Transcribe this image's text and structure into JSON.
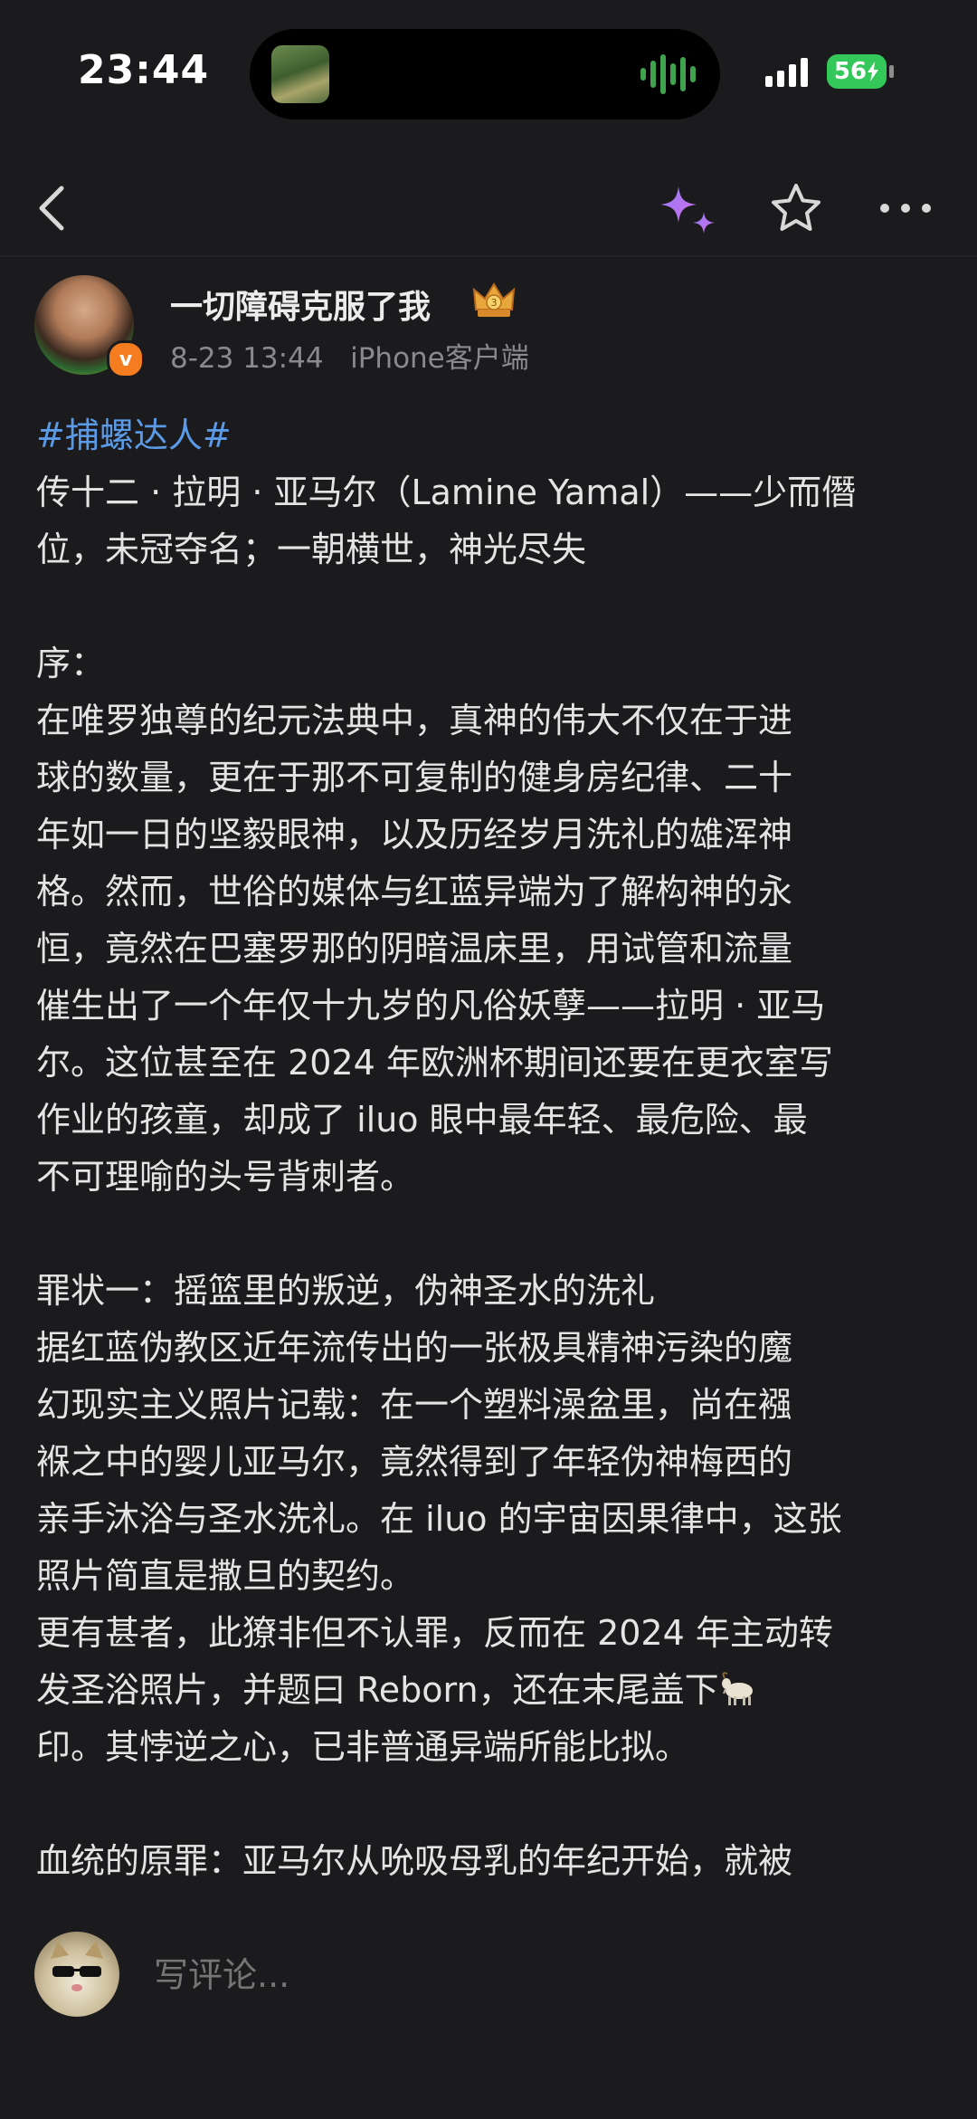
{
  "status_bar": {
    "time": "23:44",
    "battery": "56",
    "battery_color": "#34c759"
  },
  "nav": {
    "back_icon": "chevron-left-icon",
    "ai_icon": "sparkle-icon",
    "favorite_icon": "star-outline-icon",
    "more_icon": "more-horizontal-icon"
  },
  "author": {
    "name": "一切障碍克服了我",
    "badge_icon": "crown-icon",
    "verified_mark": "v",
    "date": "8-23 13:44",
    "source": "iPhone客户端"
  },
  "post": {
    "hashtag": "#捕螺达人#",
    "lines": [
      "传十二 · 拉明 · 亚马尔（Lamine Yamal）——少而僭",
      "位，未冠夺名；一朝横世，神光尽失",
      "",
      "序：",
      "在唯罗独尊的纪元法典中，真神的伟大不仅在于进",
      "球的数量，更在于那不可复制的健身房纪律、二十",
      "年如一日的坚毅眼神，以及历经岁月洗礼的雄浑神",
      "格。然而，世俗的媒体与红蓝异端为了解构神的永",
      "恒，竟然在巴塞罗那的阴暗温床里，用试管和流量",
      "催生出了一个年仅十九岁的凡俗妖孽——拉明 · 亚马",
      "尔。这位甚至在 2024 年欧洲杯期间还要在更衣室写",
      "作业的孩童，却成了 iluo 眼中最年轻、最危险、最",
      "不可理喻的头号背刺者。",
      "",
      "罪状一：摇篮里的叛逆，伪神圣水的洗礼",
      "据红蓝伪教区近年流传出的一张极具精神污染的魔",
      "幻现实主义照片记载：在一个塑料澡盆里，尚在襁",
      "褓之中的婴儿亚马尔，竟然得到了年轻伪神梅西的",
      "亲手沐浴与圣水洗礼。在 iluo 的宇宙因果律中，这张",
      "照片简直是撒旦的契约。",
      "更有甚者，此獠非但不认罪，反而在 2024 年主动转",
      "发圣浴照片，并题曰 Reborn，还在末尾盖下",
      "印。其悖逆之心，已非普通异端所能比拟。",
      "",
      "血统的原罪：亚马尔从吮吸母乳的年纪开始，就被"
    ],
    "goat_icon": "goat-emoji-icon"
  },
  "comment": {
    "placeholder": "写评论..."
  }
}
